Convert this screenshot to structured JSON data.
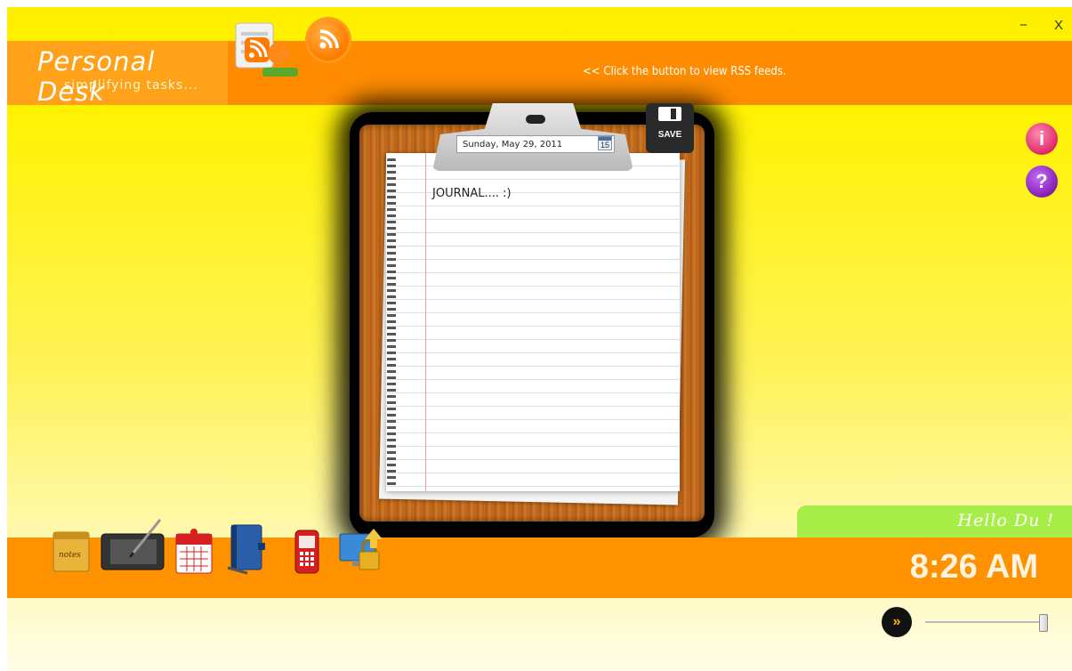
{
  "window": {
    "minimize_label": "−",
    "close_label": "X"
  },
  "header": {
    "brand_title": "Personal Desk",
    "brand_subtitle": "simplifying tasks...",
    "rss_hint": "<< Click the button to view RSS feeds."
  },
  "journal": {
    "date_value": "Sunday, May 29, 2011",
    "calendar_day": "15",
    "save_label": "SAVE",
    "content": "JOURNAL.... :)"
  },
  "greeting": "Hello Du !",
  "clock": "8:26 AM",
  "dock": [
    {
      "name": "notes",
      "icon": "notes-icon",
      "label": "notes"
    },
    {
      "name": "drawing-tablet",
      "icon": "drawing-tablet-icon"
    },
    {
      "name": "calendar",
      "icon": "calendar-icon"
    },
    {
      "name": "address-book",
      "icon": "book-icon"
    },
    {
      "name": "mobile-phone",
      "icon": "phone-icon"
    },
    {
      "name": "lock-screen",
      "icon": "lock-monitor-icon"
    }
  ],
  "player": {
    "play_icon": "»",
    "volume_level": 1.0
  },
  "colors": {
    "header_orange": "#ff8c00",
    "brand_orange": "#ffa21a",
    "greeting_green": "#a8ee48",
    "bottom_orange": "#ff9200",
    "background_yellow": "#fff200"
  }
}
